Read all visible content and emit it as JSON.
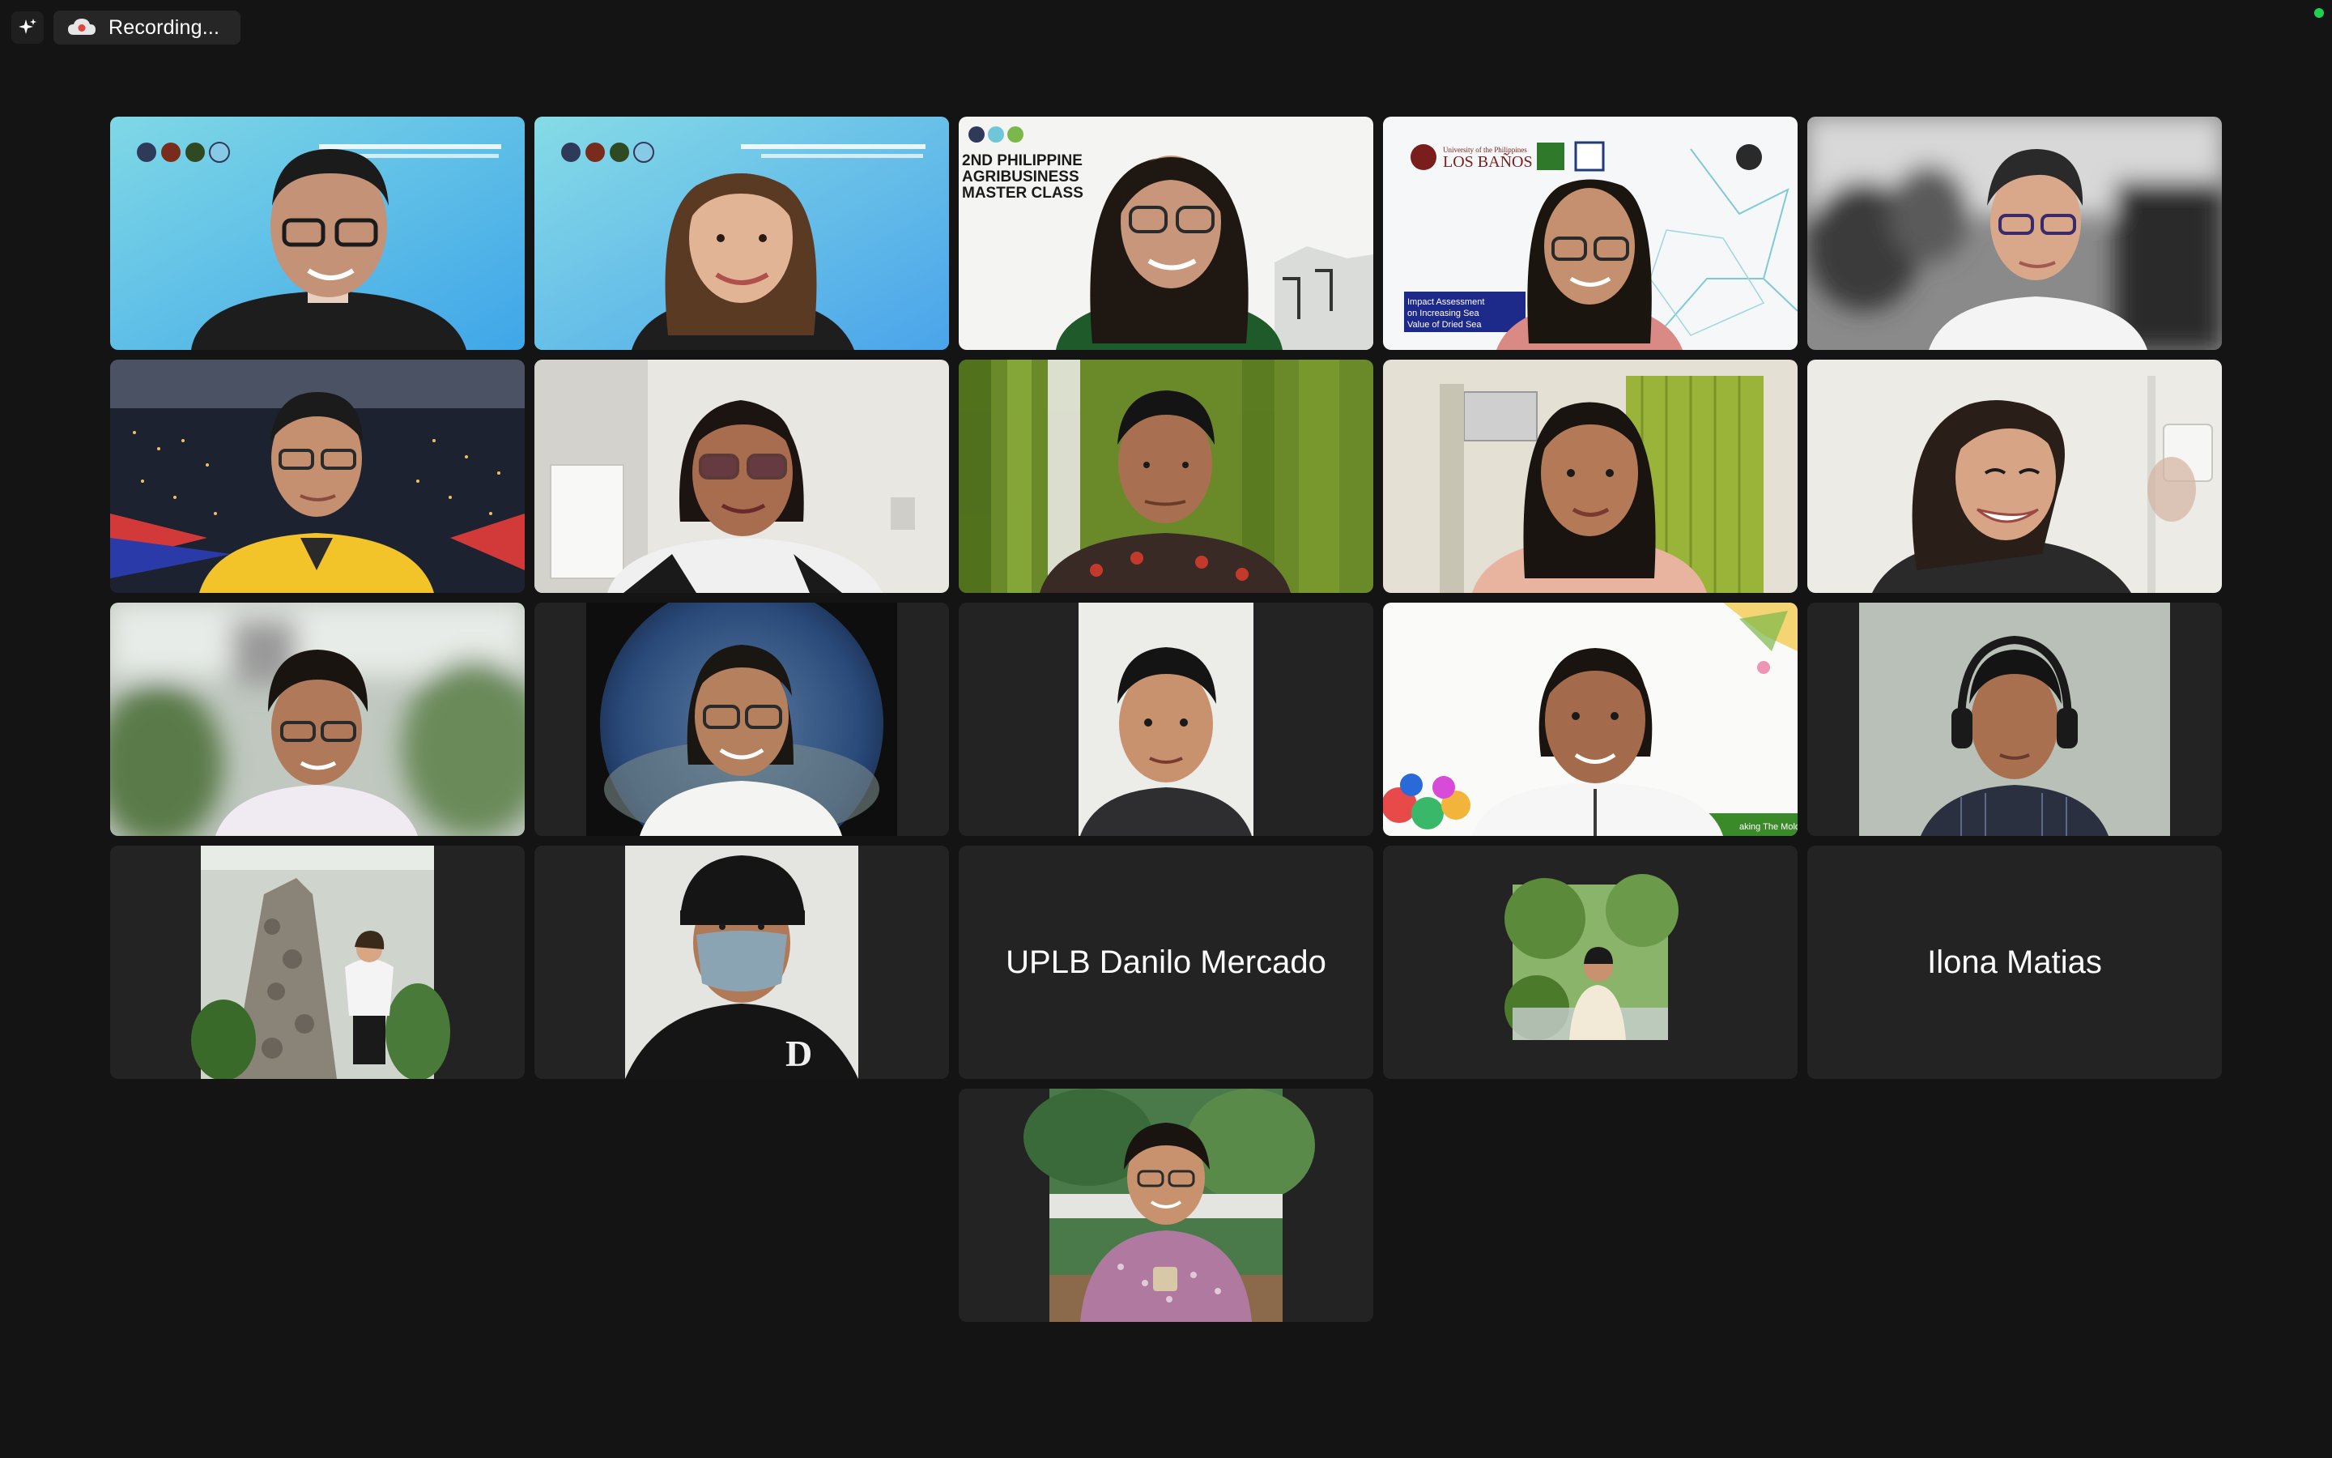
{
  "window": {
    "recording_label": "Recording...",
    "recording_icon": "cloud-record-icon",
    "ai_icon": "sparkle-icon",
    "accent_colors": {
      "active_speaker_border": "#60d34e",
      "status_dot": "#1fd14e",
      "recording_icon": "#e6e6e6",
      "recording_dot": "#e0443e"
    }
  },
  "gallery": {
    "rows": 5,
    "columns": 5,
    "participants": [
      {
        "id": "p1",
        "type": "video",
        "background": "virtual-banner-blue"
      },
      {
        "id": "p2",
        "type": "video",
        "background": "virtual-banner-blue",
        "active_speaker": true
      },
      {
        "id": "p3",
        "type": "video",
        "background": "masterclass-banner",
        "banner_text": "2ND PHILIPPINE AGRIBUSINESS MASTER CLASS"
      },
      {
        "id": "p4",
        "type": "video",
        "background": "uplb-banner",
        "banner_text": "LOS BAÑOS"
      },
      {
        "id": "p5",
        "type": "video",
        "background": "blurred-room"
      },
      {
        "id": "p6",
        "type": "video",
        "background": "city-night"
      },
      {
        "id": "p7",
        "type": "video",
        "background": "office-room"
      },
      {
        "id": "p8",
        "type": "video",
        "background": "green-curtain"
      },
      {
        "id": "p9",
        "type": "video",
        "background": "room-aircon"
      },
      {
        "id": "p10",
        "type": "video",
        "background": "white-wall"
      },
      {
        "id": "p11",
        "type": "video",
        "background": "blurred-outdoor"
      },
      {
        "id": "p12",
        "type": "video",
        "background": "underwater-circle"
      },
      {
        "id": "p13",
        "type": "video",
        "background": "plain-white"
      },
      {
        "id": "p14",
        "type": "video",
        "background": "festive-banner"
      },
      {
        "id": "p15",
        "type": "video",
        "background": "gray-wall-headphones"
      },
      {
        "id": "p16",
        "type": "photo",
        "background": "stone-monument"
      },
      {
        "id": "p17",
        "type": "photo",
        "background": "cap-and-mask"
      },
      {
        "id": "p18",
        "type": "name",
        "display_name": "UPLB Danilo Mercado"
      },
      {
        "id": "p19",
        "type": "photo",
        "background": "garden-photo"
      },
      {
        "id": "p20",
        "type": "name",
        "display_name": "Ilona Matias"
      },
      {
        "id": "p21",
        "type": "photo",
        "background": "hillside-photo"
      }
    ]
  }
}
